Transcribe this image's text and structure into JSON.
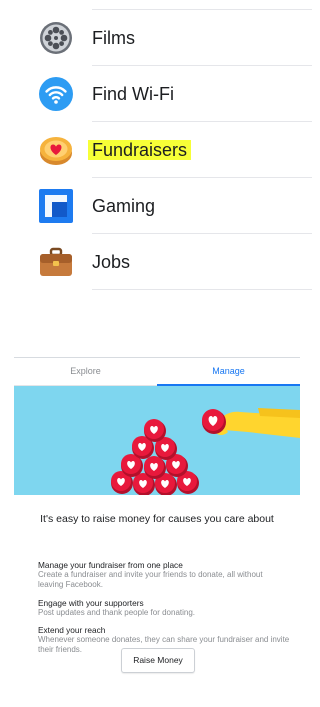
{
  "menu": {
    "items": [
      {
        "label": "Films",
        "icon": "film-reel-icon",
        "highlighted": false
      },
      {
        "label": "Find Wi-Fi",
        "icon": "wifi-icon",
        "highlighted": false
      },
      {
        "label": "Fundraisers",
        "icon": "heart-coin-icon",
        "highlighted": true
      },
      {
        "label": "Gaming",
        "icon": "gaming-icon",
        "highlighted": false
      },
      {
        "label": "Jobs",
        "icon": "briefcase-icon",
        "highlighted": false
      }
    ],
    "highlight_color": "#f7ff37"
  },
  "fundraiser": {
    "tabs": [
      {
        "label": "Explore",
        "active": false
      },
      {
        "label": "Manage",
        "active": true
      }
    ],
    "headline": "It's easy to raise money for causes you care about",
    "features": [
      {
        "title": "Manage your fundraiser from one place",
        "description": "Create a fundraiser and invite your friends to donate, all without leaving Facebook."
      },
      {
        "title": "Engage with your supporters",
        "description": "Post updates and thank people for donating."
      },
      {
        "title": "Extend your reach",
        "description": "Whenever someone donates, they can share your fundraiser and invite their friends."
      }
    ],
    "button_label": "Raise Money"
  },
  "colors": {
    "accent": "#1877f2",
    "hero_background": "#7ed6ef",
    "heart_red": "#e8193c"
  }
}
